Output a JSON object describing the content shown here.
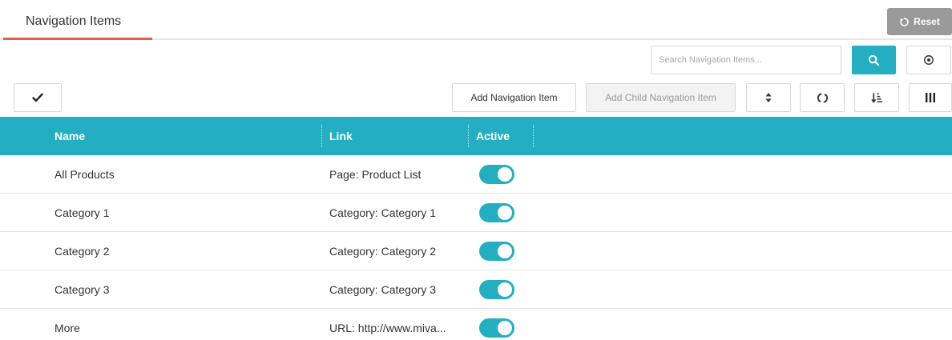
{
  "tabs": [
    {
      "label": "Navigation Items",
      "active": true
    }
  ],
  "reset_label": "Reset",
  "search": {
    "placeholder": "Search Navigation Items...",
    "value": ""
  },
  "toolbar": {
    "add_label": "Add Navigation Item",
    "add_child_label": "Add Child Navigation Item"
  },
  "icons": {
    "check": "check-icon",
    "search": "search-icon",
    "target": "target-icon",
    "sort": "sort-updown-icon",
    "refresh": "refresh-icon",
    "order": "sort-order-icon",
    "columns": "columns-icon",
    "reset": "reset-icon"
  },
  "colors": {
    "accent": "#23aec1",
    "tab_underline": "#e85d4a",
    "reset_bg": "#9a9a9a"
  },
  "table": {
    "columns": [
      "Name",
      "Link",
      "Active"
    ],
    "rows": [
      {
        "name": "All Products",
        "link": "Page: Product List",
        "active": true
      },
      {
        "name": "Category 1",
        "link": "Category: Category 1",
        "active": true
      },
      {
        "name": "Category 2",
        "link": "Category: Category 2",
        "active": true
      },
      {
        "name": "Category 3",
        "link": "Category: Category 3",
        "active": true
      },
      {
        "name": "More",
        "link": "URL: http://www.miva...",
        "active": true
      }
    ]
  }
}
